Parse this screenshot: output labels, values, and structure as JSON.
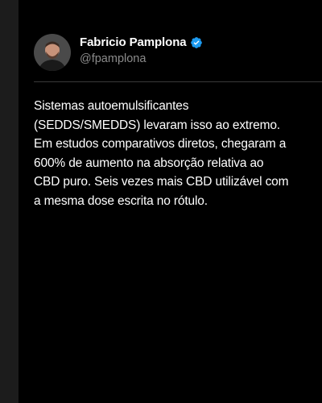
{
  "author": {
    "name": "Fabricio Pamplona",
    "handle": "@fpamplona",
    "verified": true,
    "verified_icon": "verified-badge-icon",
    "avatar_icon": "profile-photo"
  },
  "post": {
    "text": "Sistemas autoemulsificantes\n(SEDDS/SMEDDS) levaram isso ao extremo.\nEm estudos comparativos diretos, chegaram a\n600% de aumento na absorção relativa ao\nCBD puro. Seis vezes mais CBD utilizável com\na mesma dose escrita no rótulo."
  },
  "colors": {
    "background": "#000000",
    "outer_background": "#1c1c1c",
    "verified_blue": "#1d9bf0",
    "handle_gray": "#8b8b8b",
    "divider": "#3a3a3a"
  }
}
